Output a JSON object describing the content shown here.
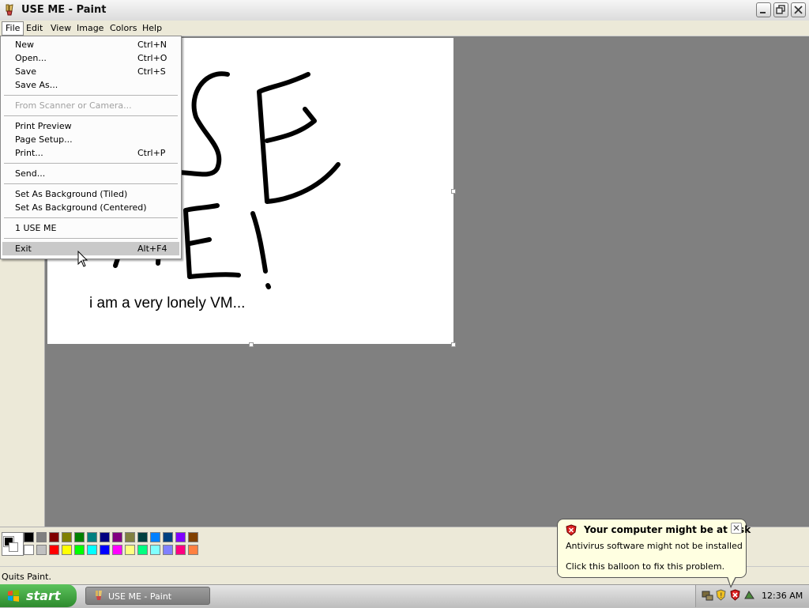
{
  "window": {
    "title": "USE ME - Paint"
  },
  "menubar": {
    "file": "File",
    "edit": "Edit",
    "view": "View",
    "image": "Image",
    "colors": "Colors",
    "help": "Help"
  },
  "file_menu": {
    "items": [
      {
        "label": "New",
        "shortcut": "Ctrl+N"
      },
      {
        "label": "Open...",
        "shortcut": "Ctrl+O"
      },
      {
        "label": "Save",
        "shortcut": "Ctrl+S"
      },
      {
        "label": "Save As...",
        "shortcut": ""
      },
      {
        "label": "From Scanner or Camera...",
        "shortcut": "",
        "disabled": true
      },
      {
        "label": "Print Preview",
        "shortcut": ""
      },
      {
        "label": "Page Setup...",
        "shortcut": ""
      },
      {
        "label": "Print...",
        "shortcut": "Ctrl+P"
      },
      {
        "label": "Send...",
        "shortcut": ""
      },
      {
        "label": "Set As Background (Tiled)",
        "shortcut": ""
      },
      {
        "label": "Set As Background (Centered)",
        "shortcut": ""
      },
      {
        "label": "1 USE ME",
        "shortcut": ""
      },
      {
        "label": "Exit",
        "shortcut": "Alt+F4",
        "highlighted": true
      }
    ]
  },
  "canvas": {
    "text": "i am a very lonely VM..."
  },
  "palette": {
    "foreground": "#000000",
    "background": "#ffffff",
    "row1": [
      "#000000",
      "#808080",
      "#800000",
      "#808000",
      "#008000",
      "#008080",
      "#000080",
      "#800080",
      "#808040",
      "#004040",
      "#0080ff",
      "#004080",
      "#8000ff",
      "#804000"
    ],
    "row2": [
      "#ffffff",
      "#c0c0c0",
      "#ff0000",
      "#ffff00",
      "#00ff00",
      "#00ffff",
      "#0000ff",
      "#ff00ff",
      "#ffff80",
      "#00ff80",
      "#80ffff",
      "#8080ff",
      "#ff0080",
      "#ff8040"
    ]
  },
  "status": {
    "text": "Quits Paint."
  },
  "balloon": {
    "title": "Your computer might be at risk",
    "line1": "Antivirus software might not be installed",
    "line2": "Click this balloon to fix this problem.",
    "close": "✕"
  },
  "taskbar": {
    "start": "start",
    "task": "USE ME - Paint",
    "clock": "12:36 AM"
  }
}
